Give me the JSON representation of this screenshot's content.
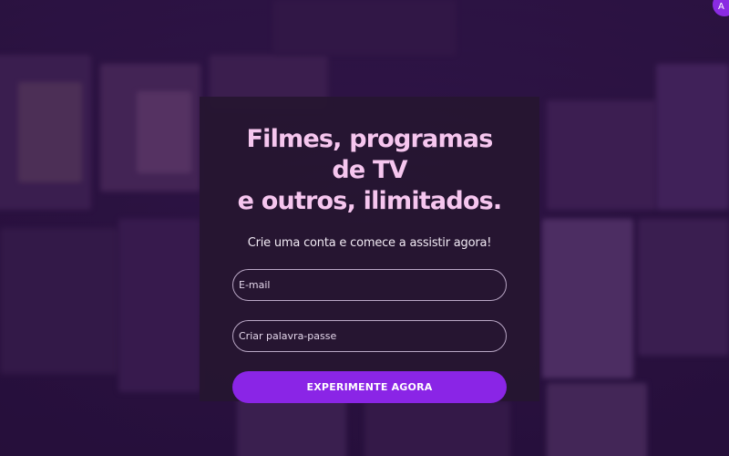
{
  "hero": {
    "title_line1": "Filmes, programas de TV",
    "title_line2": "e outros, ilimitados.",
    "subtitle": "Crie uma conta e comece a assistir agora!"
  },
  "form": {
    "email_placeholder": "E-mail",
    "password_placeholder": "Criar palavra-passe",
    "cta_label": "EXPERIMENTE AGORA"
  },
  "colors": {
    "accent": "#8a25e6",
    "title": "#f6c6ef",
    "card_bg": "#261630",
    "background": "#2a1538"
  }
}
